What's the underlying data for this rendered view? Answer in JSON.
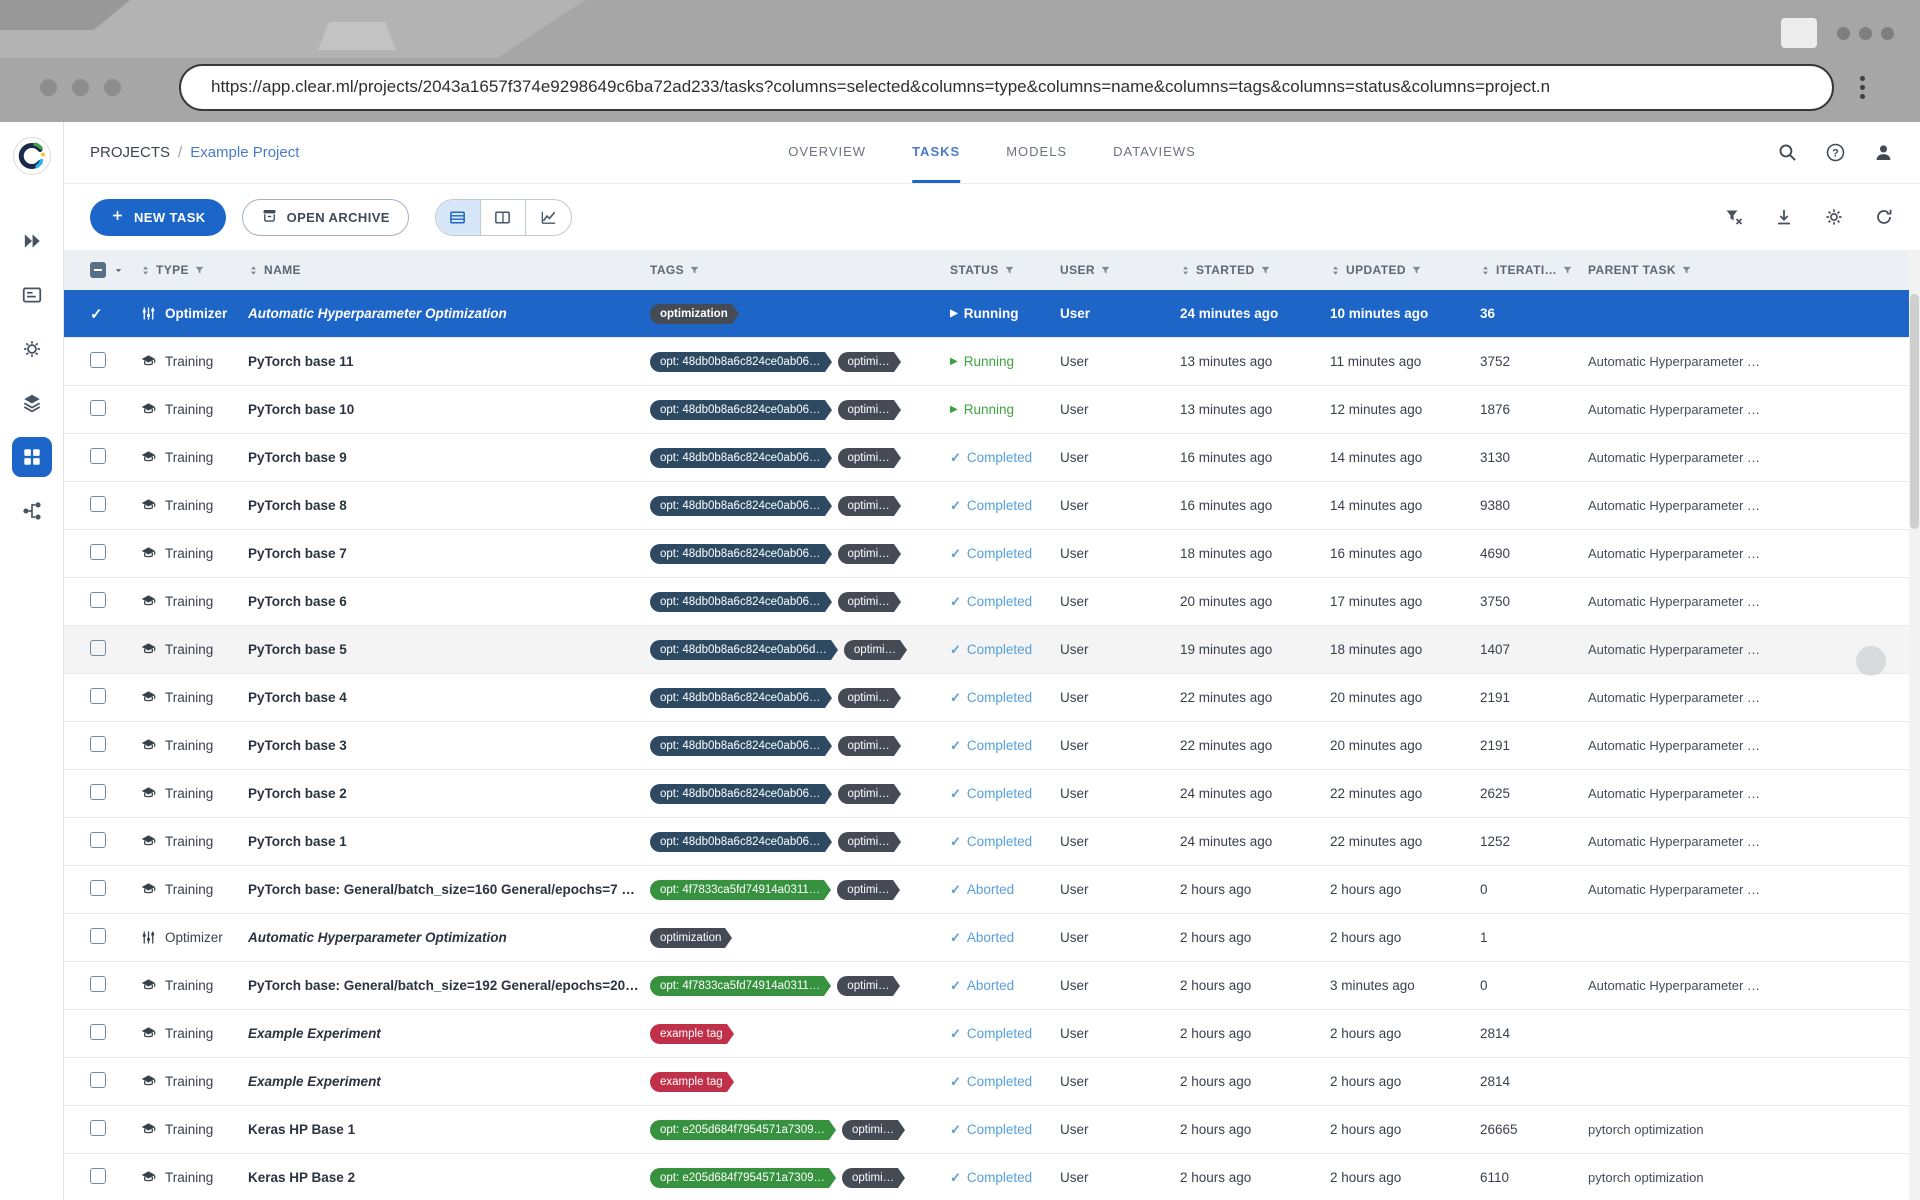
{
  "colors": {
    "primary": "#1d66c9",
    "selected_row": "#1e65c8",
    "link": "#4a7bc9",
    "running": "#3fa142",
    "completed": "#54a0dc",
    "aborted": "#54a0dc",
    "tag_navy": "#2d4a62",
    "tag_green": "#37923f",
    "tag_red": "#c13049",
    "tag_dark": "#454b54"
  },
  "browser": {
    "url": "https://app.clear.ml/projects/2043a1657f374e9298649c6ba72ad233/tasks?columns=selected&columns=type&columns=name&columns=tags&columns=status&columns=project.n"
  },
  "sidebar": {
    "items": [
      {
        "icon": "launch-icon",
        "active": false
      },
      {
        "icon": "reports-icon",
        "active": false
      },
      {
        "icon": "workers-icon",
        "active": false
      },
      {
        "icon": "datasets-icon",
        "active": false
      },
      {
        "icon": "projects-icon",
        "active": true
      },
      {
        "icon": "pipelines-icon",
        "active": false
      }
    ]
  },
  "header": {
    "breadcrumb": {
      "root": "PROJECTS",
      "separator": "/",
      "current": "Example Project"
    },
    "tabs": [
      {
        "label": "OVERVIEW",
        "active": false
      },
      {
        "label": "TASKS",
        "active": true
      },
      {
        "label": "MODELS",
        "active": false
      },
      {
        "label": "DATAVIEWS",
        "active": false
      }
    ],
    "action_icons": [
      "search-icon",
      "help-icon",
      "user-icon"
    ]
  },
  "toolbar": {
    "new_task": "NEW TASK",
    "open_archive": "OPEN ARCHIVE",
    "view_modes": [
      {
        "icon": "table-view-icon",
        "active": true
      },
      {
        "icon": "split-view-icon",
        "active": false
      },
      {
        "icon": "chart-view-icon",
        "active": false
      }
    ],
    "actions": [
      "filter-reset-icon",
      "download-icon",
      "settings-icon",
      "auto-refresh-icon"
    ]
  },
  "table": {
    "columns": [
      {
        "key": "select",
        "label": "",
        "sort": false,
        "filter": false
      },
      {
        "key": "type",
        "label": "TYPE",
        "sort": true,
        "filter": true
      },
      {
        "key": "name",
        "label": "NAME",
        "sort": true,
        "filter": false
      },
      {
        "key": "tags",
        "label": "TAGS",
        "sort": false,
        "filter": true
      },
      {
        "key": "status",
        "label": "STATUS",
        "sort": false,
        "filter": true
      },
      {
        "key": "user",
        "label": "USER",
        "sort": false,
        "filter": true
      },
      {
        "key": "started",
        "label": "STARTED",
        "sort": true,
        "filter": true
      },
      {
        "key": "updated",
        "label": "UPDATED",
        "sort": true,
        "filter": true
      },
      {
        "key": "iterations",
        "label": "ITERATI…",
        "sort": true,
        "filter": true
      },
      {
        "key": "parent",
        "label": "PARENT TASK",
        "sort": false,
        "filter": true
      }
    ],
    "rows": [
      {
        "selected": true,
        "type": "Optimizer",
        "name": "Automatic Hyperparameter Optimization",
        "italic": true,
        "tags": [
          {
            "text": "optimization",
            "color": "dark"
          }
        ],
        "status": "Running",
        "user": "User",
        "started": "24 minutes ago",
        "updated": "10 minutes ago",
        "iterations": "36",
        "parent": ""
      },
      {
        "type": "Training",
        "name": "PyTorch base 11",
        "tags": [
          {
            "text": "opt: 48db0b8a6c824ce0ab06…",
            "color": "navy"
          },
          {
            "text": "optimi…",
            "color": "dark"
          }
        ],
        "status": "Running",
        "user": "User",
        "started": "13 minutes ago",
        "updated": "11 minutes ago",
        "iterations": "3752",
        "parent": "Automatic Hyperparameter …"
      },
      {
        "type": "Training",
        "name": "PyTorch base 10",
        "tags": [
          {
            "text": "opt: 48db0b8a6c824ce0ab06…",
            "color": "navy"
          },
          {
            "text": "optimi…",
            "color": "dark"
          }
        ],
        "status": "Running",
        "user": "User",
        "started": "13 minutes ago",
        "updated": "12 minutes ago",
        "iterations": "1876",
        "parent": "Automatic Hyperparameter …"
      },
      {
        "type": "Training",
        "name": "PyTorch base 9",
        "tags": [
          {
            "text": "opt: 48db0b8a6c824ce0ab06…",
            "color": "navy"
          },
          {
            "text": "optimi…",
            "color": "dark"
          }
        ],
        "status": "Completed",
        "user": "User",
        "started": "16 minutes ago",
        "updated": "14 minutes ago",
        "iterations": "3130",
        "parent": "Automatic Hyperparameter …"
      },
      {
        "type": "Training",
        "name": "PyTorch base 8",
        "tags": [
          {
            "text": "opt: 48db0b8a6c824ce0ab06…",
            "color": "navy"
          },
          {
            "text": "optimi…",
            "color": "dark"
          }
        ],
        "status": "Completed",
        "user": "User",
        "started": "16 minutes ago",
        "updated": "14 minutes ago",
        "iterations": "9380",
        "parent": "Automatic Hyperparameter …"
      },
      {
        "type": "Training",
        "name": "PyTorch base 7",
        "tags": [
          {
            "text": "opt: 48db0b8a6c824ce0ab06…",
            "color": "navy"
          },
          {
            "text": "optimi…",
            "color": "dark"
          }
        ],
        "status": "Completed",
        "user": "User",
        "started": "18 minutes ago",
        "updated": "16 minutes ago",
        "iterations": "4690",
        "parent": "Automatic Hyperparameter …"
      },
      {
        "type": "Training",
        "name": "PyTorch base 6",
        "tags": [
          {
            "text": "opt: 48db0b8a6c824ce0ab06…",
            "color": "navy"
          },
          {
            "text": "optimi…",
            "color": "dark"
          }
        ],
        "status": "Completed",
        "user": "User",
        "started": "20 minutes ago",
        "updated": "17 minutes ago",
        "iterations": "3750",
        "parent": "Automatic Hyperparameter …"
      },
      {
        "hovered": true,
        "type": "Training",
        "name": "PyTorch base 5",
        "tags": [
          {
            "text": "opt: 48db0b8a6c824ce0ab06d…",
            "color": "navy"
          },
          {
            "text": "optimi…",
            "color": "dark"
          }
        ],
        "status": "Completed",
        "user": "User",
        "started": "19 minutes ago",
        "updated": "18 minutes ago",
        "iterations": "1407",
        "parent": "Automatic Hyperparameter …"
      },
      {
        "type": "Training",
        "name": "PyTorch base 4",
        "tags": [
          {
            "text": "opt: 48db0b8a6c824ce0ab06…",
            "color": "navy"
          },
          {
            "text": "optimi…",
            "color": "dark"
          }
        ],
        "status": "Completed",
        "user": "User",
        "started": "22 minutes ago",
        "updated": "20 minutes ago",
        "iterations": "2191",
        "parent": "Automatic Hyperparameter …"
      },
      {
        "type": "Training",
        "name": "PyTorch base 3",
        "tags": [
          {
            "text": "opt: 48db0b8a6c824ce0ab06…",
            "color": "navy"
          },
          {
            "text": "optimi…",
            "color": "dark"
          }
        ],
        "status": "Completed",
        "user": "User",
        "started": "22 minutes ago",
        "updated": "20 minutes ago",
        "iterations": "2191",
        "parent": "Automatic Hyperparameter …"
      },
      {
        "type": "Training",
        "name": "PyTorch base 2",
        "tags": [
          {
            "text": "opt: 48db0b8a6c824ce0ab06…",
            "color": "navy"
          },
          {
            "text": "optimi…",
            "color": "dark"
          }
        ],
        "status": "Completed",
        "user": "User",
        "started": "24 minutes ago",
        "updated": "22 minutes ago",
        "iterations": "2625",
        "parent": "Automatic Hyperparameter …"
      },
      {
        "type": "Training",
        "name": "PyTorch base 1",
        "tags": [
          {
            "text": "opt: 48db0b8a6c824ce0ab06…",
            "color": "navy"
          },
          {
            "text": "optimi…",
            "color": "dark"
          }
        ],
        "status": "Completed",
        "user": "User",
        "started": "24 minutes ago",
        "updated": "22 minutes ago",
        "iterations": "1252",
        "parent": "Automatic Hyperparameter …"
      },
      {
        "type": "Training",
        "name": "PyTorch base: General/batch_size=160 General/epochs=7 …",
        "tags": [
          {
            "text": "opt: 4f7833ca5fd74914a0311…",
            "color": "green"
          },
          {
            "text": "optimi…",
            "color": "dark"
          }
        ],
        "status": "Aborted",
        "user": "User",
        "started": "2 hours ago",
        "updated": "2 hours ago",
        "iterations": "0",
        "parent": "Automatic Hyperparameter …"
      },
      {
        "type": "Optimizer",
        "name": "Automatic Hyperparameter Optimization",
        "italic": true,
        "tags": [
          {
            "text": "optimization",
            "color": "dark"
          }
        ],
        "status": "Aborted",
        "user": "User",
        "started": "2 hours ago",
        "updated": "2 hours ago",
        "iterations": "1",
        "parent": ""
      },
      {
        "type": "Training",
        "name": "PyTorch base: General/batch_size=192 General/epochs=20…",
        "tags": [
          {
            "text": "opt: 4f7833ca5fd74914a0311…",
            "color": "green"
          },
          {
            "text": "optimi…",
            "color": "dark"
          }
        ],
        "status": "Aborted",
        "user": "User",
        "started": "2 hours ago",
        "updated": "3 minutes ago",
        "iterations": "0",
        "parent": "Automatic Hyperparameter …"
      },
      {
        "type": "Training",
        "name": "Example Experiment",
        "italic": true,
        "tags": [
          {
            "text": "example tag",
            "color": "red"
          }
        ],
        "status": "Completed",
        "user": "User",
        "started": "2 hours ago",
        "updated": "2 hours ago",
        "iterations": "2814",
        "parent": ""
      },
      {
        "type": "Training",
        "name": "Example Experiment",
        "italic": true,
        "tags": [
          {
            "text": "example tag",
            "color": "red"
          }
        ],
        "status": "Completed",
        "user": "User",
        "started": "2 hours ago",
        "updated": "2 hours ago",
        "iterations": "2814",
        "parent": ""
      },
      {
        "type": "Training",
        "name": "Keras HP Base 1",
        "tags": [
          {
            "text": "opt: e205d684f7954571a7309…",
            "color": "green"
          },
          {
            "text": "optimi…",
            "color": "dark"
          }
        ],
        "status": "Completed",
        "user": "User",
        "started": "2 hours ago",
        "updated": "2 hours ago",
        "iterations": "26665",
        "parent": "pytorch optimization"
      },
      {
        "type": "Training",
        "name": "Keras HP Base 2",
        "tags": [
          {
            "text": "opt: e205d684f7954571a7309…",
            "color": "green"
          },
          {
            "text": "optimi…",
            "color": "dark"
          }
        ],
        "status": "Completed",
        "user": "User",
        "started": "2 hours ago",
        "updated": "2 hours ago",
        "iterations": "6110",
        "parent": "pytorch optimization"
      }
    ]
  }
}
